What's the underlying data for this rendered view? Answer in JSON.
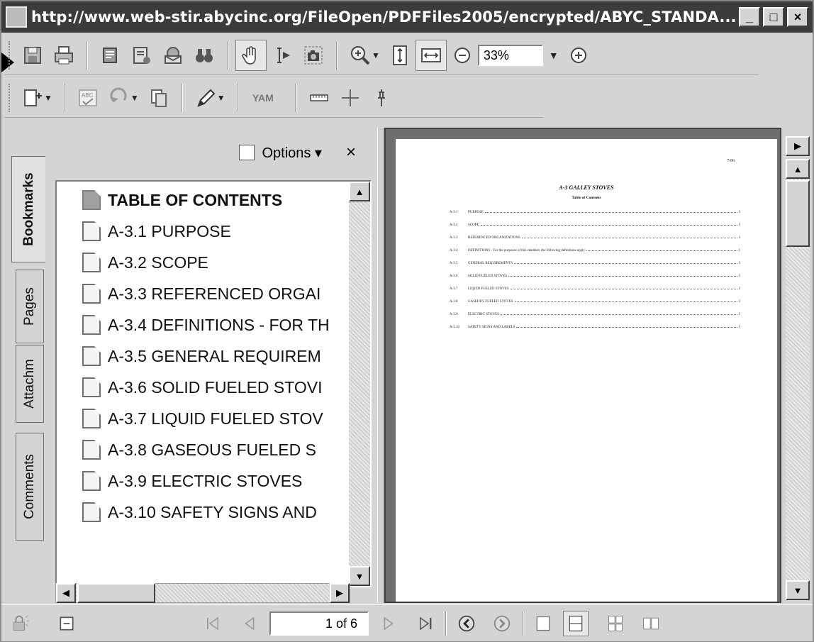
{
  "window": {
    "title": "http://www.web-stir.abycinc.org/FileOpen/PDFFiles2005/encrypted/ABYC_STANDA...",
    "minimize": "_",
    "maximize": "□",
    "close": "×"
  },
  "toolbar": {
    "zoom_value": "33%"
  },
  "side_tabs": [
    {
      "label": "Bookmarks"
    },
    {
      "label": "Pages"
    },
    {
      "label": "Attachm"
    },
    {
      "label": "Comments"
    }
  ],
  "bookmarks_panel": {
    "options_label": "Options ▾",
    "close_label": "×",
    "items": [
      {
        "label": "TABLE OF CONTENTS"
      },
      {
        "label": "A-3.1 PURPOSE"
      },
      {
        "label": "A-3.2 SCOPE"
      },
      {
        "label": "A-3.3 REFERENCED ORGAI"
      },
      {
        "label": "A-3.4 DEFINITIONS - FOR TH"
      },
      {
        "label": "A-3.5 GENERAL REQUIREM"
      },
      {
        "label": "A-3.6 SOLID FUELED STOVI"
      },
      {
        "label": "A-3.7 LIQUID FUELED STOV"
      },
      {
        "label": "A-3.8 GASEOUS FUELED S"
      },
      {
        "label": "A-3.9 ELECTRIC STOVES"
      },
      {
        "label": "A-3.10 SAFETY SIGNS AND"
      }
    ]
  },
  "document": {
    "page_number": "7/06",
    "title": "A-3 GALLEY STOVES",
    "subtitle": "Table of Contents",
    "toc": [
      {
        "num": "A-3.1",
        "text": "PURPOSE",
        "page": "1"
      },
      {
        "num": "A-3.2",
        "text": "SCOPE",
        "page": "1"
      },
      {
        "num": "A-3.3",
        "text": "REFERENCED ORGANIZATIONS",
        "page": "1"
      },
      {
        "num": "A-3.4",
        "text": "DEFINITIONS - For the purposes of this standard, the following definitions apply",
        "page": "1"
      },
      {
        "num": "A-3.5",
        "text": "GENERAL REQUIREMENTS",
        "page": "1"
      },
      {
        "num": "A-3.6",
        "text": "SOLID FUELED STOVES",
        "page": "2"
      },
      {
        "num": "A-3.7",
        "text": "LIQUID FUELED STOVES",
        "page": "2"
      },
      {
        "num": "A-3.8",
        "text": "GASEOUS FUELED STOVES",
        "page": "3"
      },
      {
        "num": "A-3.9",
        "text": "ELECTRIC STOVES",
        "page": "3"
      },
      {
        "num": "A-3.10",
        "text": "SAFETY SIGNS AND LABELS",
        "page": "3"
      }
    ]
  },
  "statusbar": {
    "page_indicator": "1 of 6"
  }
}
